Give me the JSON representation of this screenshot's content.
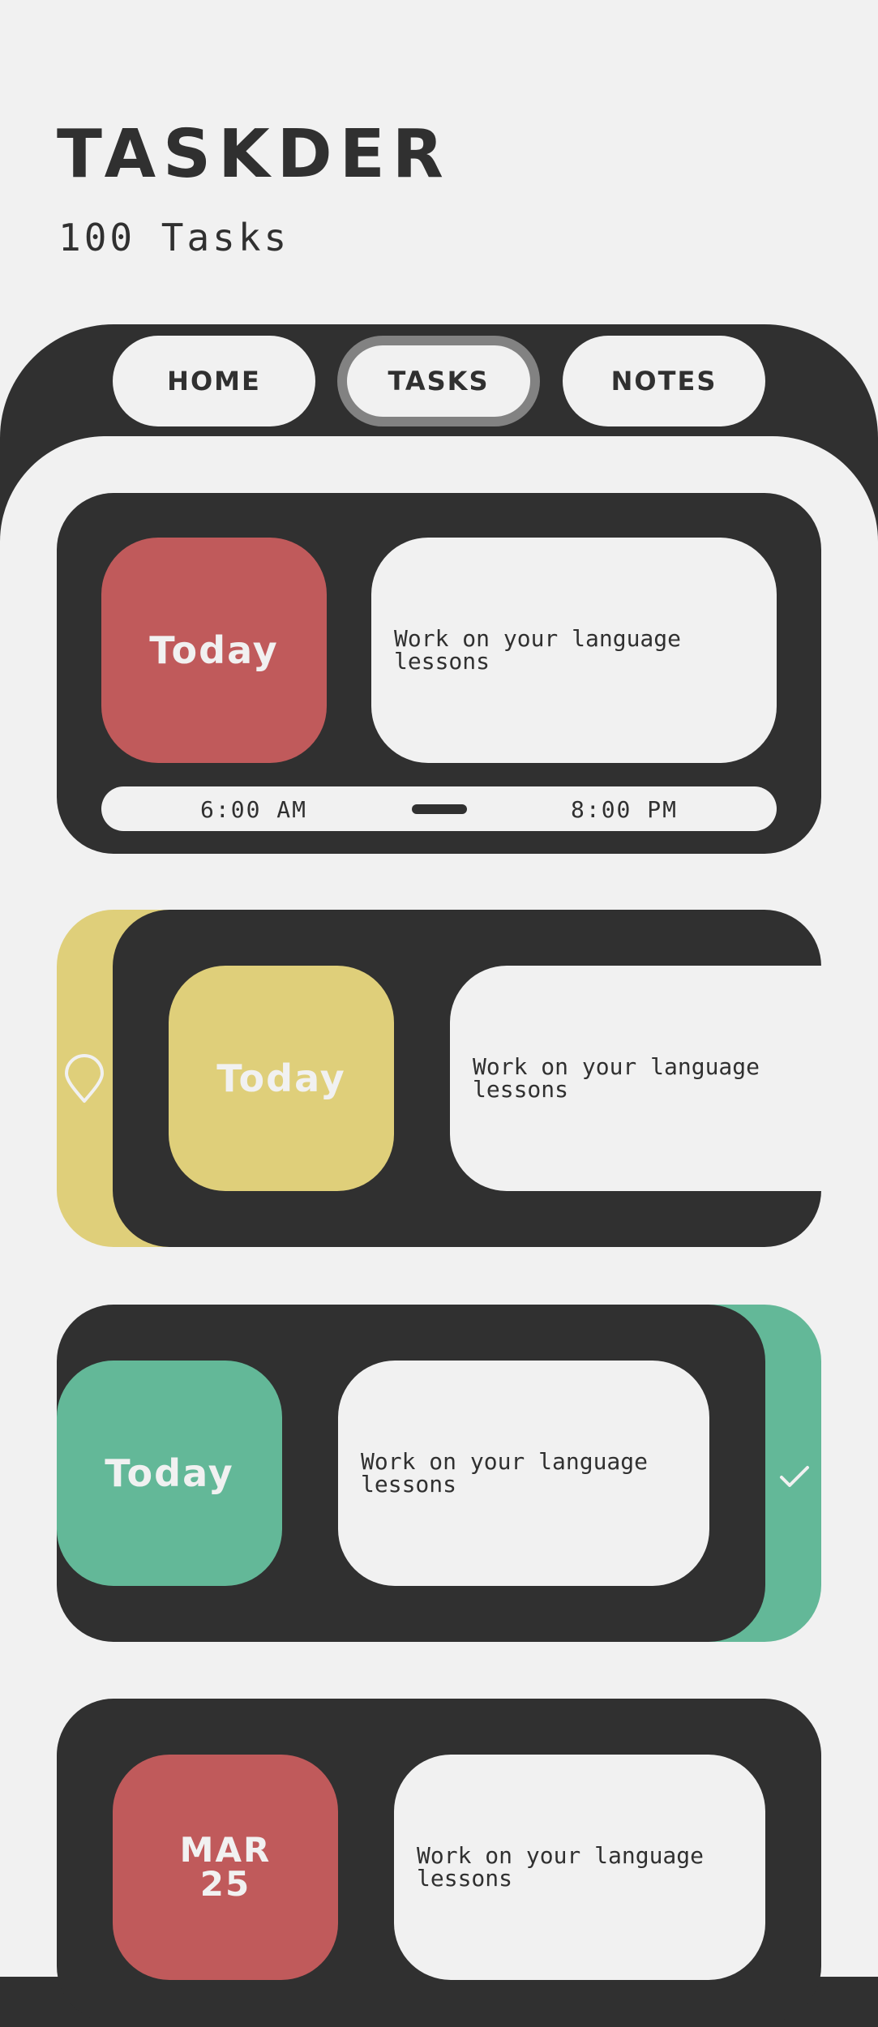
{
  "header": {
    "title": "TASKDER",
    "subtitle": "100 Tasks"
  },
  "nav": {
    "items": [
      {
        "label": "HOME",
        "active": false
      },
      {
        "label": "TASKS",
        "active": true
      },
      {
        "label": "NOTES",
        "active": false
      }
    ]
  },
  "colors": {
    "dark": "#303030",
    "light": "#f1f1f1",
    "red": "#c05a5b",
    "yellow": "#dfcf7a",
    "green": "#63b898",
    "nav_active_border": "#828282"
  },
  "tasks": [
    {
      "day": "Today",
      "text": "Work on your language lessons",
      "color": "red",
      "time_start": "6:00 AM",
      "time_end": "8:00 PM"
    },
    {
      "day": "Today",
      "text": "Work on your language lessons",
      "color": "yellow",
      "action_icon": "location-pin-icon"
    },
    {
      "day": "Today",
      "text": "Work on your language lessons",
      "color": "green",
      "action_icon": "check-icon"
    },
    {
      "day_month": "MAR",
      "day_num": "25",
      "text": "Work on your language lessons",
      "color": "red"
    }
  ]
}
